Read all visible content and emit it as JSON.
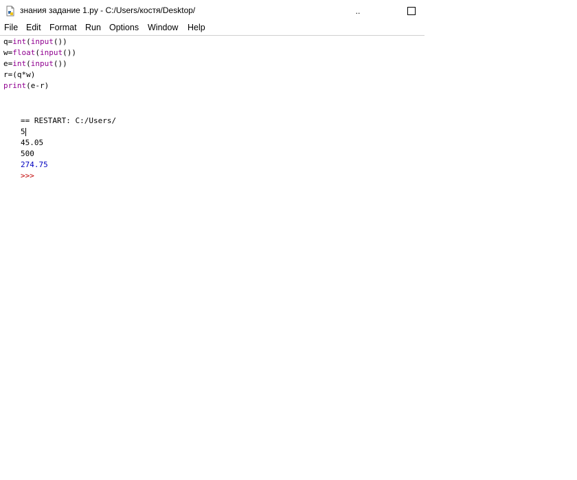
{
  "window": {
    "title": "знания задание 1.py - C:/Users/костя/Desktop/",
    "minimize_glyph": "..",
    "icon": "python-file-icon"
  },
  "menu": {
    "items": [
      "File",
      "Edit",
      "Format",
      "Run",
      "Options",
      "Window",
      "Help"
    ]
  },
  "code": {
    "lines": [
      {
        "pre": "q=",
        "kw1": "int",
        "mid": "(",
        "kw2": "input",
        "post": "())"
      },
      {
        "pre": "w=",
        "kw1": "float",
        "mid": "(",
        "kw2": "input",
        "post": "())"
      },
      {
        "pre": "e=",
        "kw1": "int",
        "mid": "(",
        "kw2": "input",
        "post": "())"
      },
      {
        "pre": "r=(q*w)",
        "kw1": "",
        "mid": "",
        "kw2": "",
        "post": ""
      },
      {
        "pre": "",
        "kw1": "print",
        "mid": "(e-r)",
        "kw2": "",
        "post": ""
      }
    ]
  },
  "shell": {
    "restart": "== RESTART: C:/Users/",
    "input1": "5",
    "input2": "45.05",
    "input3": "500",
    "result": "274.75",
    "prompt": ">>>"
  },
  "colors": {
    "keyword": "#900090",
    "output": "#0000c0",
    "prompt": "#c00000"
  }
}
